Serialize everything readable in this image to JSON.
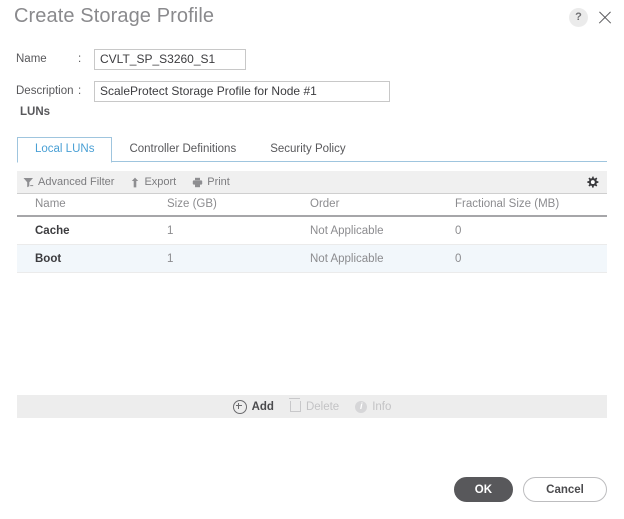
{
  "dialog": {
    "title": "Create Storage Profile",
    "help_icon": "?",
    "close_icon": "close-icon"
  },
  "form": {
    "name": {
      "label": "Name",
      "separator": ":",
      "value": "CVLT_SP_S3260_S1"
    },
    "description": {
      "label": "Description",
      "separator": ":",
      "value": "ScaleProtect Storage Profile for Node #1"
    },
    "section_label": "LUNs"
  },
  "tabs": [
    {
      "label": "Local LUNs",
      "active": true
    },
    {
      "label": "Controller Definitions",
      "active": false
    },
    {
      "label": "Security Policy",
      "active": false
    }
  ],
  "toolbar": {
    "advanced_filter": "Advanced Filter",
    "export": "Export",
    "print": "Print",
    "settings_icon": "gear-icon"
  },
  "table": {
    "columns": [
      "Name",
      "Size (GB)",
      "Order",
      "Fractional Size (MB)"
    ],
    "rows": [
      {
        "name": "Cache",
        "size": "1",
        "order": "Not Applicable",
        "fractional": "0",
        "selected": false
      },
      {
        "name": "Boot",
        "size": "1",
        "order": "Not Applicable",
        "fractional": "0",
        "selected": true
      }
    ]
  },
  "actions": {
    "add": "Add",
    "delete": "Delete",
    "info": "Info"
  },
  "footer": {
    "ok": "OK",
    "cancel": "Cancel"
  },
  "colors": {
    "accent": "#4aa0d5",
    "tab_border": "#9fc5de",
    "row_selected": "#f2f7fb",
    "toolbar_bg": "#f0f0f0",
    "action_bar_bg": "#ededed",
    "ok_button": "#58585b",
    "text": "#58585b"
  }
}
